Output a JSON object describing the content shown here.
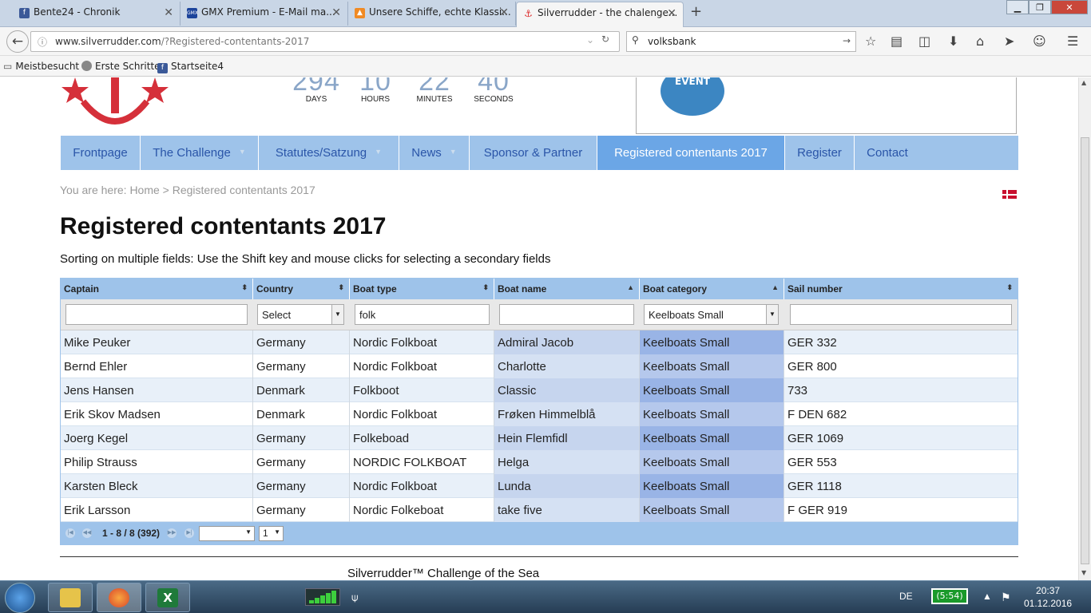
{
  "browser": {
    "tabs": [
      {
        "title": "Bente24 - Chronik",
        "icon": "facebook-icon"
      },
      {
        "title": "GMX Premium - E-Mail ma...",
        "icon": "gmx-icon"
      },
      {
        "title": "Unsere Schiffe, echte Klassi...",
        "icon": "flame-icon"
      },
      {
        "title": "Silverrudder - the chalenge...",
        "icon": "anchor-icon"
      }
    ],
    "url_host": "www.silverrudder.com",
    "url_path": "/?Registered-contentants-2017",
    "search_value": "volksbank",
    "bookmarks": [
      "Meistbesucht",
      "Erste Schritte",
      "Startseite4"
    ]
  },
  "site": {
    "countdown": [
      {
        "value": "294",
        "label": "DAYS"
      },
      {
        "value": "10",
        "label": "HOURS"
      },
      {
        "value": "22",
        "label": "MINUTES"
      },
      {
        "value": "40",
        "label": "SECONDS"
      }
    ],
    "event_badge": "EVENT",
    "menu": [
      {
        "label": "Frontpage",
        "has_caret": false,
        "active": false
      },
      {
        "label": "The Challenge",
        "has_caret": true,
        "active": false
      },
      {
        "label": "Statutes/Satzung",
        "has_caret": true,
        "active": false
      },
      {
        "label": "News",
        "has_caret": true,
        "active": false
      },
      {
        "label": "Sponsor & Partner",
        "has_caret": false,
        "active": false
      },
      {
        "label": "Registered contentants 2017",
        "has_caret": false,
        "active": true
      },
      {
        "label": "Register",
        "has_caret": false,
        "active": false
      },
      {
        "label": "Contact",
        "has_caret": false,
        "active": false
      }
    ],
    "breadcrumb": "You are here: Home > Registered contentants 2017",
    "title": "Registered contentants 2017",
    "hint": "Sorting on multiple fields: Use the Shift key and mouse clicks for selecting a secondary fields",
    "footer": "Silverrudder™ Challenge of the Sea"
  },
  "grid": {
    "columns": [
      "Captain",
      "Country",
      "Boat type",
      "Boat name",
      "Boat category",
      "Sail number"
    ],
    "filters": {
      "captain": "",
      "country": "Select",
      "boat_type": "folk",
      "boat_name": "",
      "boat_category": "Keelboats Small",
      "sail_number": ""
    },
    "rows": [
      [
        "Mike Peuker",
        "Germany",
        "Nordic Folkboat",
        "Admiral Jacob",
        "Keelboats Small",
        "GER 332"
      ],
      [
        "Bernd Ehler",
        "Germany",
        "Nordic Folkboat",
        "Charlotte",
        "Keelboats Small",
        "GER 800"
      ],
      [
        "Jens Hansen",
        "Denmark",
        "Folkboot",
        "Classic",
        "Keelboats Small",
        "733"
      ],
      [
        "Erik Skov Madsen",
        "Denmark",
        "Nordic Folkboat",
        "Frøken Himmelblå",
        "Keelboats Small",
        "F DEN 682"
      ],
      [
        "Joerg Kegel",
        "Germany",
        "Folkeboad",
        "Hein Flemfidl",
        "Keelboats Small",
        "GER 1069"
      ],
      [
        "Philip Strauss",
        "Germany",
        "NORDIC FOLKBOAT",
        "Helga",
        "Keelboats Small",
        "GER 553"
      ],
      [
        "Karsten Bleck",
        "Germany",
        "Nordic Folkboat",
        "Lunda",
        "Keelboats Small",
        "GER 1118"
      ],
      [
        "Erik Larsson",
        "Germany",
        "Nordic Folkeboat",
        "take five",
        "Keelboats Small",
        "F GER 919"
      ]
    ],
    "pager": {
      "info": "1 - 8 / 8 (392)",
      "page_size": "",
      "page": "1"
    }
  },
  "taskbar": {
    "language": "DE",
    "battery": "(5:54)",
    "time": "20:37",
    "date": "01.12.2016"
  }
}
